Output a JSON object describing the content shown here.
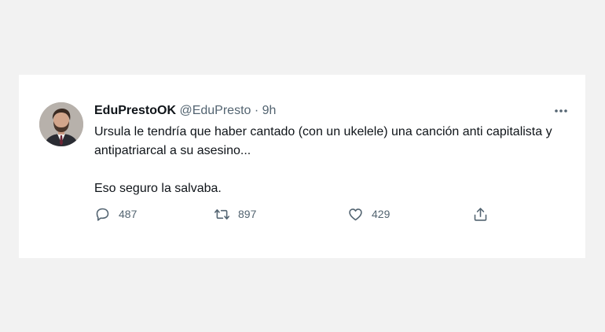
{
  "tweet": {
    "display_name": "EduPrestoOK",
    "handle": "@EduPresto",
    "separator": "·",
    "time": "9h",
    "more_icon": "more-horizontal-icon",
    "text_paragraph_1": "Ursula le tendría que haber cantado (con un ukelele) una canción anti capitalista y antipatriarcal a su asesino...",
    "text_paragraph_2": "Eso seguro la salvaba.",
    "actions": {
      "reply": {
        "icon": "reply-icon",
        "count": "487"
      },
      "retweet": {
        "icon": "retweet-icon",
        "count": "897"
      },
      "like": {
        "icon": "heart-icon",
        "count": "429"
      },
      "share": {
        "icon": "share-icon"
      }
    }
  },
  "colors": {
    "background": "#f2f2f2",
    "card": "#ffffff",
    "primary_text": "#0f1419",
    "secondary_text": "#536471"
  }
}
